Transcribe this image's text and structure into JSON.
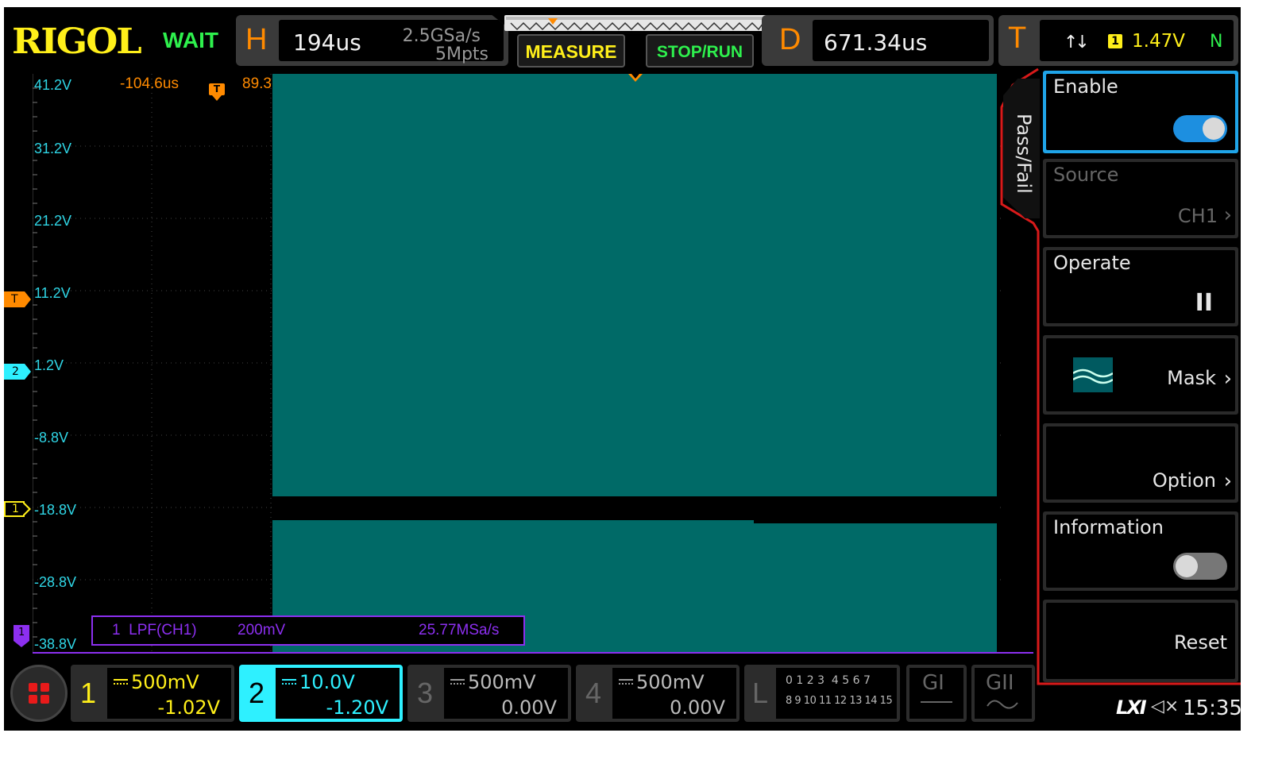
{
  "brand": "RIGOL",
  "status": "WAIT",
  "horizontal": {
    "letter": "H",
    "timebase": "194us",
    "sample_rate": "2.5GSa/s",
    "memory_depth": "5Mpts"
  },
  "buttons": {
    "measure": "MEASURE",
    "stop_run": "STOP/RUN"
  },
  "delay": {
    "letter": "D",
    "value": "671.34us"
  },
  "trigger": {
    "letter": "T",
    "edge_symbol": "↑↓",
    "channel": "1",
    "level": "1.47V",
    "mode": "N"
  },
  "waveform": {
    "cursor_time": "-104.6us",
    "cursor_time2": "89.3",
    "y_labels": [
      "41.2V",
      "31.2V",
      "21.2V",
      "11.2V",
      "1.2V",
      "-8.8V",
      "-18.8V",
      "-28.8V",
      "-38.8V"
    ],
    "markers": {
      "trigger": "T",
      "ch2": "2",
      "ch1": "1",
      "math": "1"
    }
  },
  "math_bar": {
    "label": "1  LPF(CH1)",
    "scale": "200mV",
    "rate": "25.77MSa/s"
  },
  "side_tab": "Pass/Fail",
  "softkeys": {
    "enable": {
      "label": "Enable",
      "on": true
    },
    "source": {
      "label": "Source",
      "value": "CH1"
    },
    "operate": {
      "label": "Operate",
      "value": "II"
    },
    "mask": {
      "label": "Mask"
    },
    "option": {
      "label": "Option"
    },
    "information": {
      "label": "Information",
      "on": false
    },
    "reset": {
      "label": "Reset"
    }
  },
  "channels": [
    {
      "num": "1",
      "scale": "500mV",
      "offset": "-1.02V"
    },
    {
      "num": "2",
      "scale": "10.0V",
      "offset": "-1.20V"
    },
    {
      "num": "3",
      "scale": "500mV",
      "offset": "0.00V"
    },
    {
      "num": "4",
      "scale": "500mV",
      "offset": "0.00V"
    }
  ],
  "logic": {
    "letter": "L",
    "row1": "0 1 2 3  4 5 6 7",
    "row2": "8 9 10 11 12 13 14 15"
  },
  "gi": "GI",
  "gii": "GII",
  "footer": {
    "lxi": "LXI",
    "mute_icon": "speaker-muted-icon",
    "time": "15:35"
  },
  "colors": {
    "ch1": "#ffef1a",
    "ch2": "#2ef0ff",
    "trigger": "#ff8a00",
    "math": "#8c2ff0",
    "waveform": "#006a67",
    "active_menu": "#1fa4e8",
    "menu_border": "#d81a1a"
  }
}
